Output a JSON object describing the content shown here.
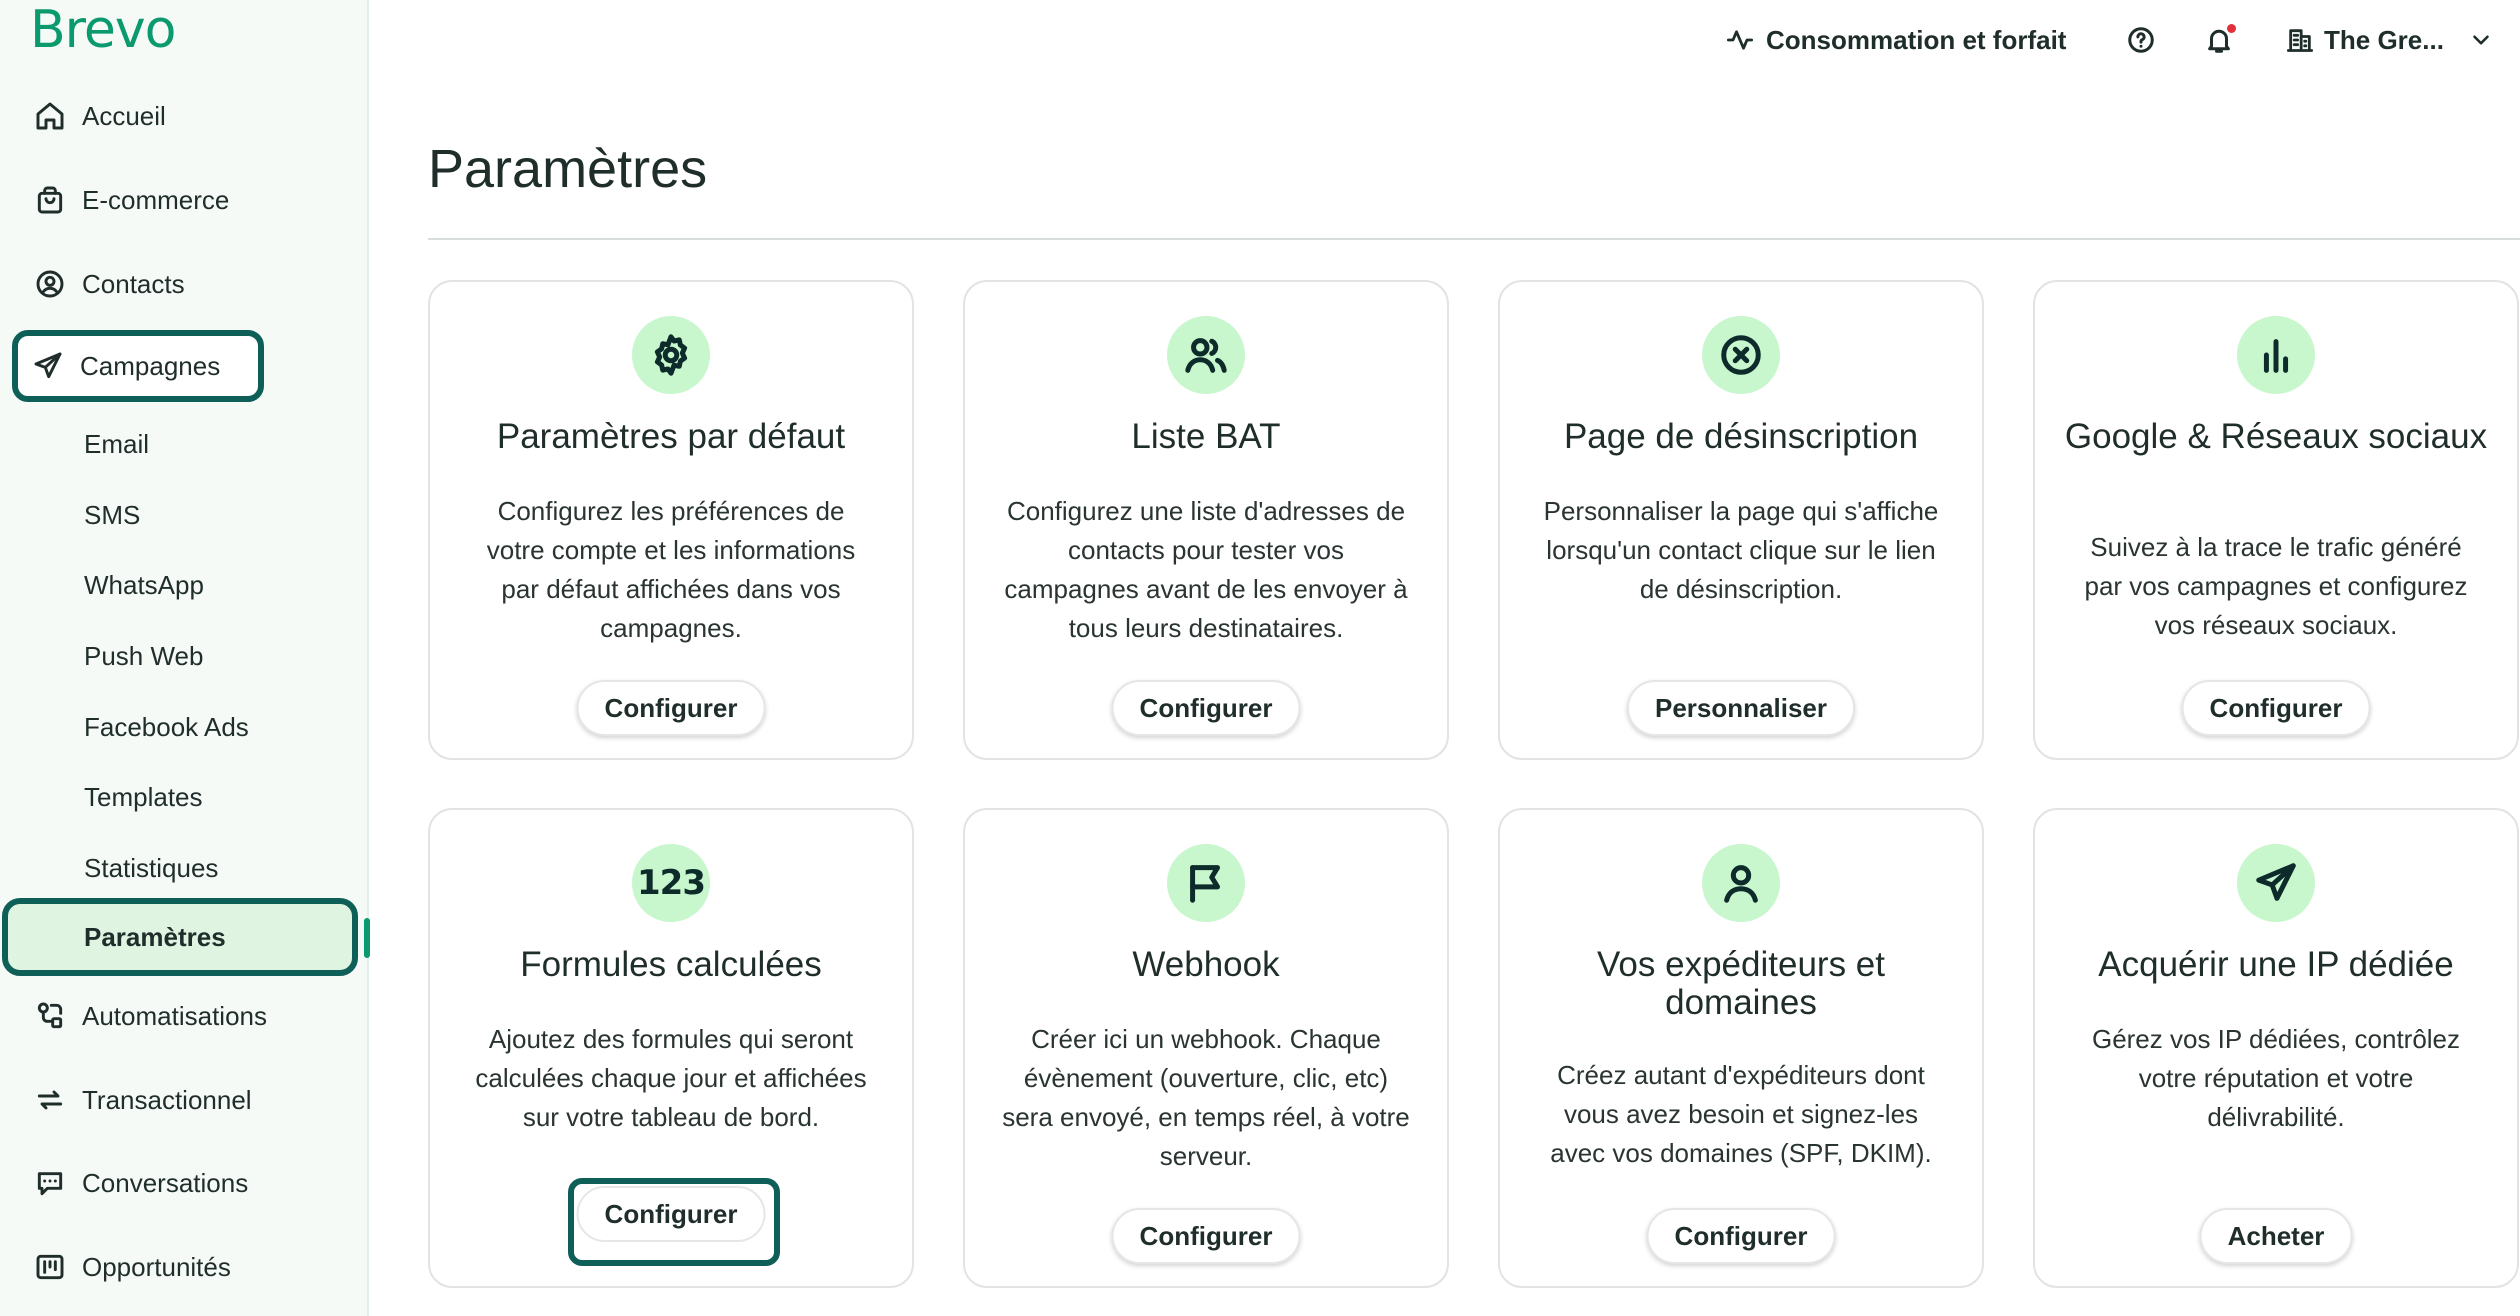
{
  "brand": "Brevo",
  "sidebar": {
    "items": [
      {
        "label": "Accueil",
        "icon": "home-icon"
      },
      {
        "label": "E-commerce",
        "icon": "shopping-bag-icon"
      },
      {
        "label": "Contacts",
        "icon": "contact-icon"
      },
      {
        "label": "Campagnes",
        "icon": "send-icon"
      },
      {
        "label": "Automatisations",
        "icon": "automation-icon"
      },
      {
        "label": "Transactionnel",
        "icon": "transfer-icon"
      },
      {
        "label": "Conversations",
        "icon": "chat-icon"
      },
      {
        "label": "Opportunités",
        "icon": "kanban-icon"
      }
    ],
    "campaign_subitems": [
      "Email",
      "SMS",
      "WhatsApp",
      "Push Web",
      "Facebook Ads",
      "Templates",
      "Statistiques",
      "Paramètres"
    ]
  },
  "topbar": {
    "usage_label": "Consommation et forfait",
    "account_label": "The Gre..."
  },
  "page_title": "Paramètres",
  "cards": [
    {
      "title": "Paramètres par défaut",
      "description": "Configurez les préférences de votre compte et les informations par défaut affichées dans vos campagnes.",
      "button": "Configurer",
      "icon": "gear-icon"
    },
    {
      "title": "Liste BAT",
      "description": "Configurez une liste d'adresses de contacts pour tester vos campagnes avant de les envoyer à tous leurs destinataires.",
      "button": "Configurer",
      "icon": "users-icon"
    },
    {
      "title": "Page de désinscription",
      "description": "Personnaliser la page qui s'affiche lorsqu'un contact clique sur le lien de désinscription.",
      "button": "Personnaliser",
      "icon": "close-circle-icon"
    },
    {
      "title": "Google & Réseaux sociaux",
      "description": "Suivez à la trace le trafic généré par vos campagnes et configurez vos réseaux sociaux.",
      "button": "Configurer",
      "icon": "bar-chart-icon"
    },
    {
      "title": "Formules calculées",
      "description": "Ajoutez des formules qui seront calculées chaque jour et affichées sur votre tableau de bord.",
      "button": "Configurer",
      "icon": "numbers-icon",
      "icon_text": "123"
    },
    {
      "title": "Webhook",
      "description": "Créer ici un webhook. Chaque évènement (ouverture, clic, etc) sera envoyé, en temps réel, à votre serveur.",
      "button": "Configurer",
      "icon": "flag-icon"
    },
    {
      "title": "Vos expéditeurs et domaines",
      "description": "Créez autant d'expéditeurs dont vous avez besoin et signez-les avec vos domaines (SPF, DKIM).",
      "button": "Configurer",
      "icon": "user-icon"
    },
    {
      "title": "Acquérir une IP dédiée",
      "description": "Gérez vos IP dédiées, contrôlez votre réputation et votre délivrabilité.",
      "button": "Acheter",
      "icon": "send-icon"
    }
  ]
}
